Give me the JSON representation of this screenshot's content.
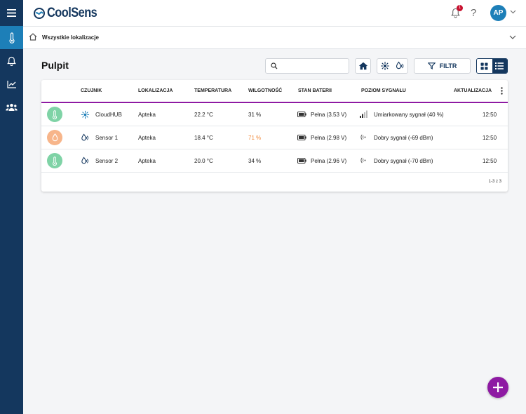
{
  "app": {
    "brand": "CoolSens"
  },
  "header": {
    "notifications_count": "1",
    "help_label": "?",
    "user_initials": "AP"
  },
  "location": {
    "label": "Wszystkie lokalizacje"
  },
  "page": {
    "title": "Pulpit"
  },
  "search": {
    "placeholder": "",
    "value": ""
  },
  "toolbar": {
    "filter_label": "FILTR"
  },
  "table": {
    "columns": [
      "CZUJNIK",
      "LOKALIZACJA",
      "TEMPERATURA",
      "WILGOTNOŚĆ",
      "STAN BATERII",
      "POZIOM SYGNAŁU",
      "AKTUALIZACJA"
    ],
    "rows": [
      {
        "status": "ok",
        "icon": "hub-icon",
        "name": "CloudHUB",
        "location": "Apteka",
        "temperature": "22.2 °C",
        "humidity": "31 %",
        "humidity_alert": false,
        "battery": "Pełna (3.53 V)",
        "signal": "Umiarkowany sygnał (40 %)",
        "signal_icon": "signal-bars-icon",
        "updated": "12:50"
      },
      {
        "status": "warn",
        "icon": "sensor-icon",
        "name": "Sensor 1",
        "location": "Apteka",
        "temperature": "18.4 °C",
        "humidity": "71 %",
        "humidity_alert": true,
        "battery": "Pełna (2.98 V)",
        "signal": "Dobry sygnał (-69 dBm)",
        "signal_icon": "radio-signal-icon",
        "updated": "12:50"
      },
      {
        "status": "ok",
        "icon": "sensor-icon",
        "name": "Sensor 2",
        "location": "Apteka",
        "temperature": "20.0 °C",
        "humidity": "34 %",
        "humidity_alert": false,
        "battery": "Pełna (2.96 V)",
        "signal": "Dobry sygnał (-70 dBm)",
        "signal_icon": "radio-signal-icon",
        "updated": "12:50"
      }
    ],
    "pagination": "1-3 z 3"
  },
  "colors": {
    "sidebar": "#14375e",
    "accent": "#1d7fb8",
    "header_divider": "#8e1aa3",
    "status_ok": "#7fd3a6",
    "status_warn": "#f7b58a",
    "humidity_alert": "#f08a3c",
    "fab": "#8e1aa3"
  }
}
